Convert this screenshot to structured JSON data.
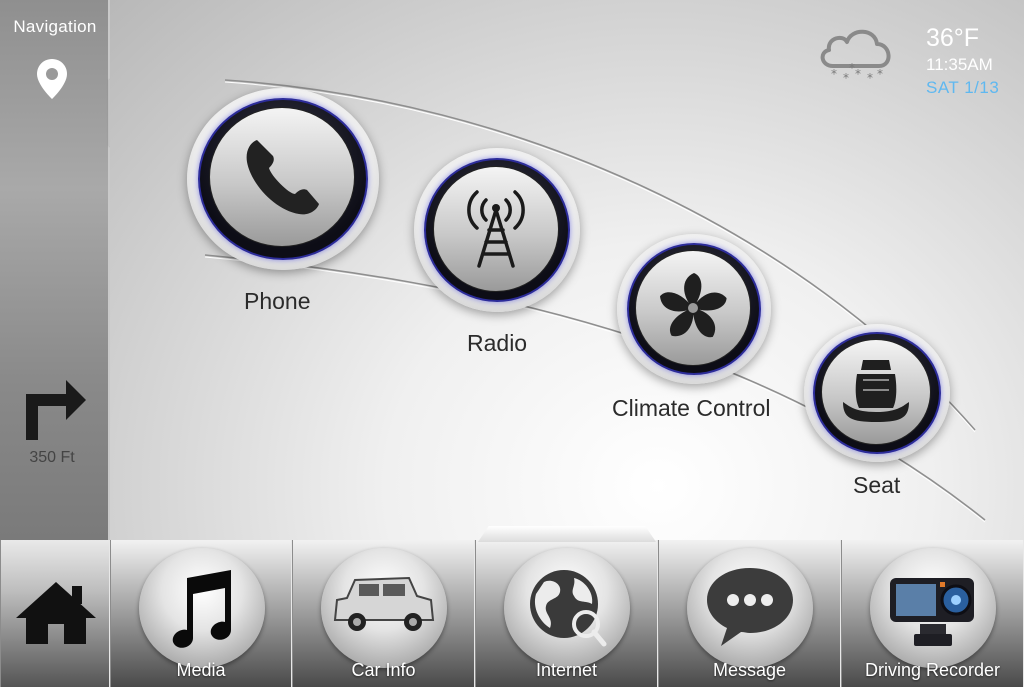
{
  "navigation": {
    "title": "Navigation",
    "distance": "350 Ft"
  },
  "weather": {
    "temperature": "36°F",
    "time": "11:35AM",
    "date": "SAT 1/13",
    "icon": "snow-cloud-icon"
  },
  "features": [
    {
      "label": "Phone",
      "icon": "phone-icon"
    },
    {
      "label": "Radio",
      "icon": "radio-tower-icon"
    },
    {
      "label": "Climate Control",
      "icon": "fan-icon"
    },
    {
      "label": "Seat",
      "icon": "seat-icon"
    }
  ],
  "dock": {
    "home_icon": "home-icon",
    "items": [
      {
        "label": "Media",
        "icon": "music-note-icon"
      },
      {
        "label": "Car Info",
        "icon": "car-icon"
      },
      {
        "label": "Internet",
        "icon": "globe-search-icon"
      },
      {
        "label": "Message",
        "icon": "chat-bubble-icon"
      },
      {
        "label": "Driving Recorder",
        "icon": "dashcam-icon"
      }
    ]
  },
  "colors": {
    "date_accent": "#5fb8f0",
    "ring_glow": "#2c2c9a"
  }
}
